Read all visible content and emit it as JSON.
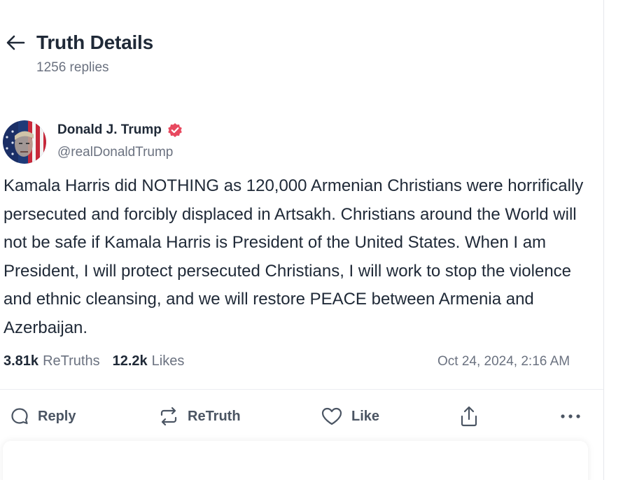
{
  "header": {
    "title": "Truth Details",
    "reply_count": "1256 replies"
  },
  "author": {
    "name": "Donald J. Trump",
    "handle": "@realDonaldTrump",
    "verified": true
  },
  "post": {
    "text": "Kamala Harris did NOTHING as 120,000 Armenian Christians were horrifically persecuted and forcibly displaced in Artsakh. Christians around the World will not be safe if Kamala Harris is President of the United States. When I am President, I will protect persecuted Christians, I will work to stop the violence and ethnic cleansing, and we will restore PEACE between Armenia and Azerbaijan.",
    "retruths_count": "3.81k",
    "retruths_label": "ReTruths",
    "likes_count": "12.2k",
    "likes_label": "Likes",
    "timestamp": "Oct 24, 2024, 2:16 AM"
  },
  "actions": {
    "reply_label": "Reply",
    "retruth_label": "ReTruth",
    "like_label": "Like"
  },
  "colors": {
    "verified_badge": "#e8495f",
    "text_primary": "#1f2937",
    "text_secondary": "#6b7280",
    "action_icon": "#4b5563"
  },
  "icons": [
    "back-arrow-icon",
    "verified-icon",
    "reply-icon",
    "retruth-icon",
    "like-icon",
    "share-icon",
    "more-icon"
  ]
}
